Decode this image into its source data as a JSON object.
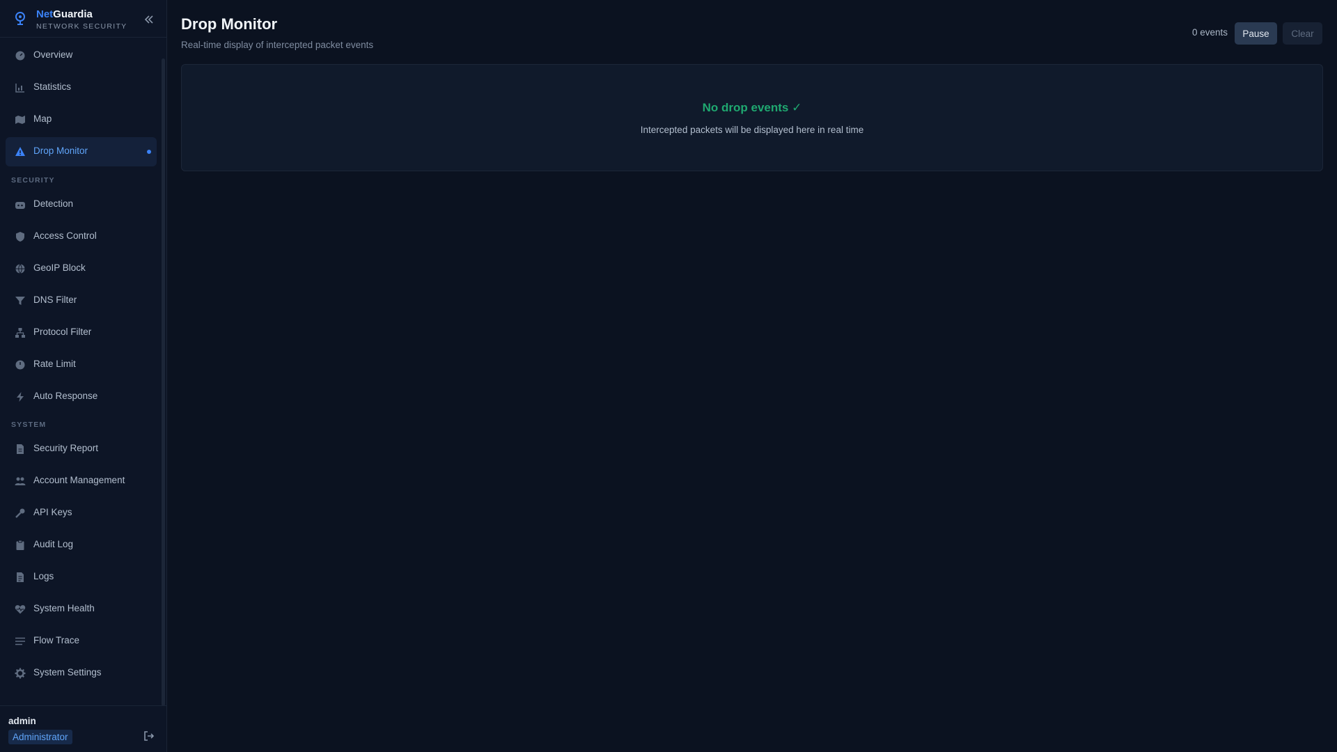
{
  "brand": {
    "name_part1": "Net",
    "name_part2": "Guardia",
    "subtitle": "NETWORK SECURITY"
  },
  "sidebar": {
    "items": [
      {
        "id": "overview",
        "label": "Overview",
        "icon": "gauge-icon"
      },
      {
        "id": "statistics",
        "label": "Statistics",
        "icon": "bar-chart-icon"
      },
      {
        "id": "map",
        "label": "Map",
        "icon": "map-icon"
      },
      {
        "id": "drop-monitor",
        "label": "Drop Monitor",
        "icon": "warning-triangle-icon",
        "active": true
      }
    ],
    "security_label": "SECURITY",
    "security_items": [
      {
        "id": "detection",
        "label": "Detection",
        "icon": "robot-icon"
      },
      {
        "id": "access-control",
        "label": "Access Control",
        "icon": "shield-icon"
      },
      {
        "id": "geoip-block",
        "label": "GeoIP Block",
        "icon": "globe-icon"
      },
      {
        "id": "dns-filter",
        "label": "DNS Filter",
        "icon": "funnel-icon"
      },
      {
        "id": "protocol-filter",
        "label": "Protocol Filter",
        "icon": "network-icon"
      },
      {
        "id": "rate-limit",
        "label": "Rate Limit",
        "icon": "gauge-icon"
      },
      {
        "id": "auto-response",
        "label": "Auto Response",
        "icon": "lightning-icon"
      }
    ],
    "system_label": "SYSTEM",
    "system_items": [
      {
        "id": "security-report",
        "label": "Security Report",
        "icon": "document-icon"
      },
      {
        "id": "account-management",
        "label": "Account Management",
        "icon": "users-icon"
      },
      {
        "id": "api-keys",
        "label": "API Keys",
        "icon": "key-icon"
      },
      {
        "id": "audit-log",
        "label": "Audit Log",
        "icon": "clipboard-icon"
      },
      {
        "id": "logs",
        "label": "Logs",
        "icon": "file-icon"
      },
      {
        "id": "system-health",
        "label": "System Health",
        "icon": "heartbeat-icon"
      },
      {
        "id": "flow-trace",
        "label": "Flow Trace",
        "icon": "list-icon"
      },
      {
        "id": "system-settings",
        "label": "System Settings",
        "icon": "gear-icon"
      }
    ]
  },
  "user": {
    "name": "admin",
    "role": "Administrator"
  },
  "main": {
    "title": "Drop Monitor",
    "subtitle": "Real-time display of intercepted packet events",
    "event_count": "0 events",
    "pause_label": "Pause",
    "clear_label": "Clear",
    "empty_title": "No drop events ✓",
    "empty_desc": "Intercepted packets will be displayed here in real time"
  },
  "colors": {
    "accent": "#3b82f6",
    "success": "#1fa870",
    "background": "#0b1220"
  }
}
